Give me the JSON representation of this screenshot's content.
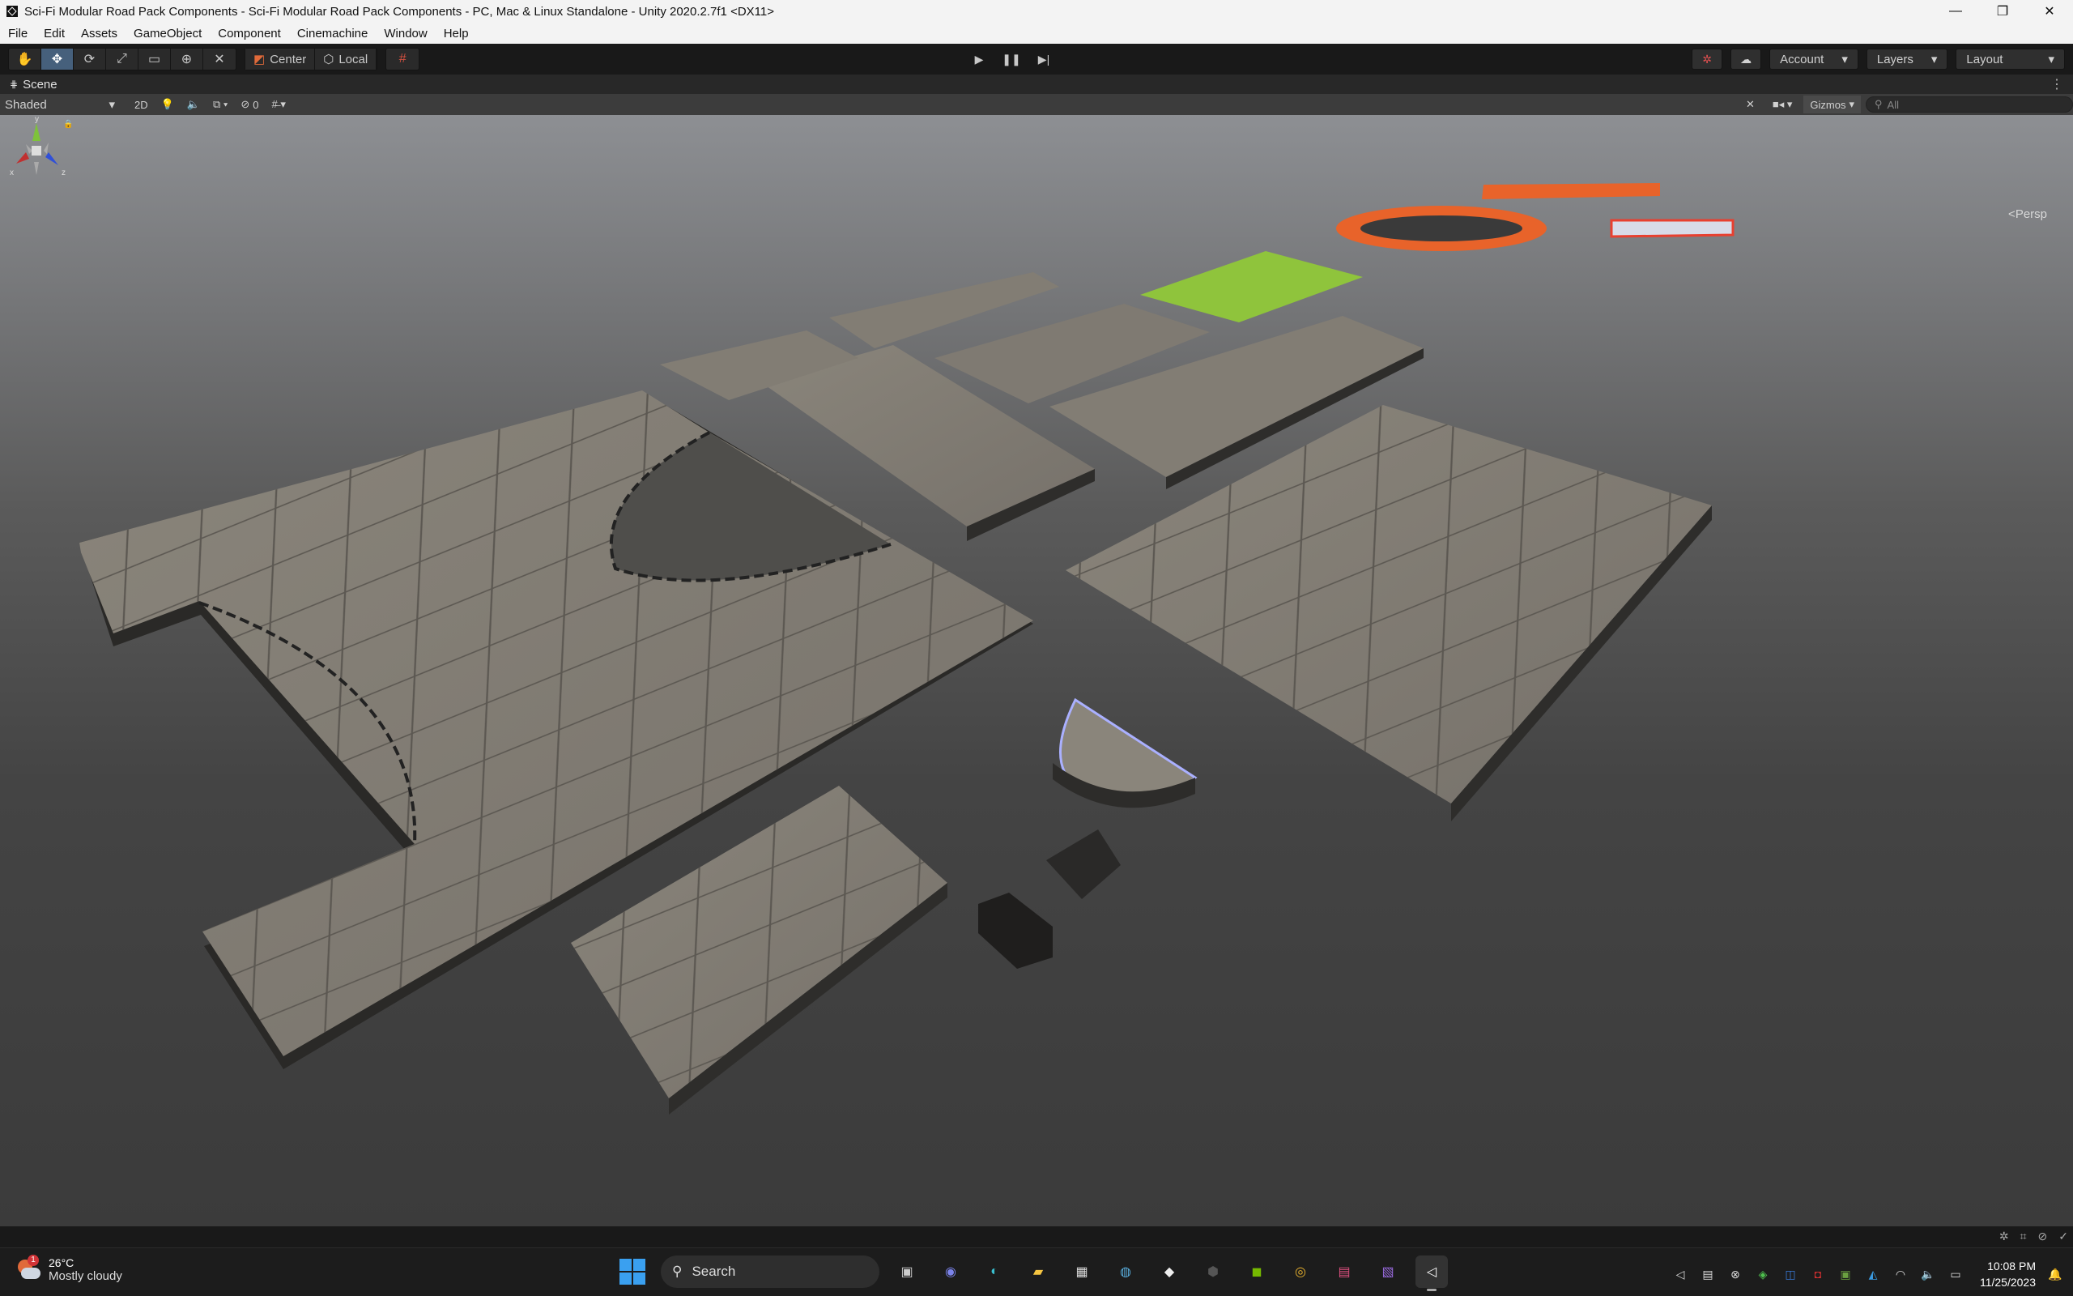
{
  "window": {
    "title": "Sci-Fi Modular Road Pack Components - Sci-Fi Modular Road Pack Components - PC, Mac & Linux Standalone - Unity 2020.2.7f1 <DX11>",
    "minimize": "—",
    "maximize": "❐",
    "close": "✕"
  },
  "menu": [
    "File",
    "Edit",
    "Assets",
    "GameObject",
    "Component",
    "Cinemachine",
    "Window",
    "Help"
  ],
  "toolbar": {
    "pivot_mode": "Center",
    "pivot_rotation": "Local",
    "account": "Account",
    "layers": "Layers",
    "layout": "Layout"
  },
  "scene_tab": {
    "label": "Scene"
  },
  "scene_toolbar": {
    "shading": "Shaded",
    "mode_2d": "2D",
    "hidden_count": "0",
    "gizmos": "Gizmos",
    "search_placeholder": "All"
  },
  "viewport": {
    "projection": "Persp",
    "axis_labels": {
      "y": "y",
      "x": "x",
      "z": "z"
    }
  },
  "taskbar": {
    "weather_temp": "26°C",
    "weather_desc": "Mostly cloudy",
    "weather_badge": "1",
    "search_label": "Search",
    "time": "10:08 PM",
    "date": "11/25/2023"
  },
  "colors": {
    "accent_active_tool": "#46607c",
    "viewport_top": "#8d8f93",
    "viewport_bottom": "#3b3b3b",
    "grass": "#8fc43c",
    "track_orange": "#e8632a"
  }
}
